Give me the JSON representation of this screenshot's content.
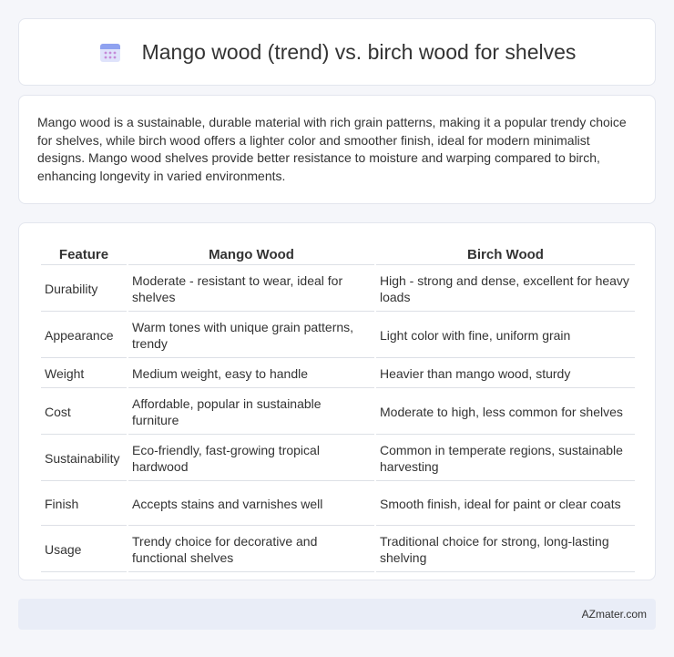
{
  "header": {
    "title": "Mango wood (trend) vs. birch wood for shelves",
    "icon": "calendar-icon"
  },
  "intro": {
    "text": "Mango wood is a sustainable, durable material with rich grain patterns, making it a popular trendy choice for shelves, while birch wood offers a lighter color and smoother finish, ideal for modern minimalist designs. Mango wood shelves provide better resistance to moisture and warping compared to birch, enhancing longevity in varied environments."
  },
  "table": {
    "headers": [
      "Feature",
      "Mango Wood",
      "Birch Wood"
    ],
    "rows": [
      [
        "Durability",
        "Moderate - resistant to wear, ideal for shelves",
        "High - strong and dense, excellent for heavy loads"
      ],
      [
        "Appearance",
        "Warm tones with unique grain patterns, trendy",
        "Light color with fine, uniform grain"
      ],
      [
        "Weight",
        "Medium weight, easy to handle",
        "Heavier than mango wood, sturdy"
      ],
      [
        "Cost",
        "Affordable, popular in sustainable furniture",
        "Moderate to high, less common for shelves"
      ],
      [
        "Sustainability",
        "Eco-friendly, fast-growing tropical hardwood",
        "Common in temperate regions, sustainable harvesting"
      ],
      [
        "Finish",
        "Accepts stains and varnishes well",
        "Smooth finish, ideal for paint or clear coats"
      ],
      [
        "Usage",
        "Trendy choice for decorative and functional shelves",
        "Traditional choice for strong, long-lasting shelving"
      ]
    ]
  },
  "footer": {
    "brand": "AZmater.com"
  }
}
